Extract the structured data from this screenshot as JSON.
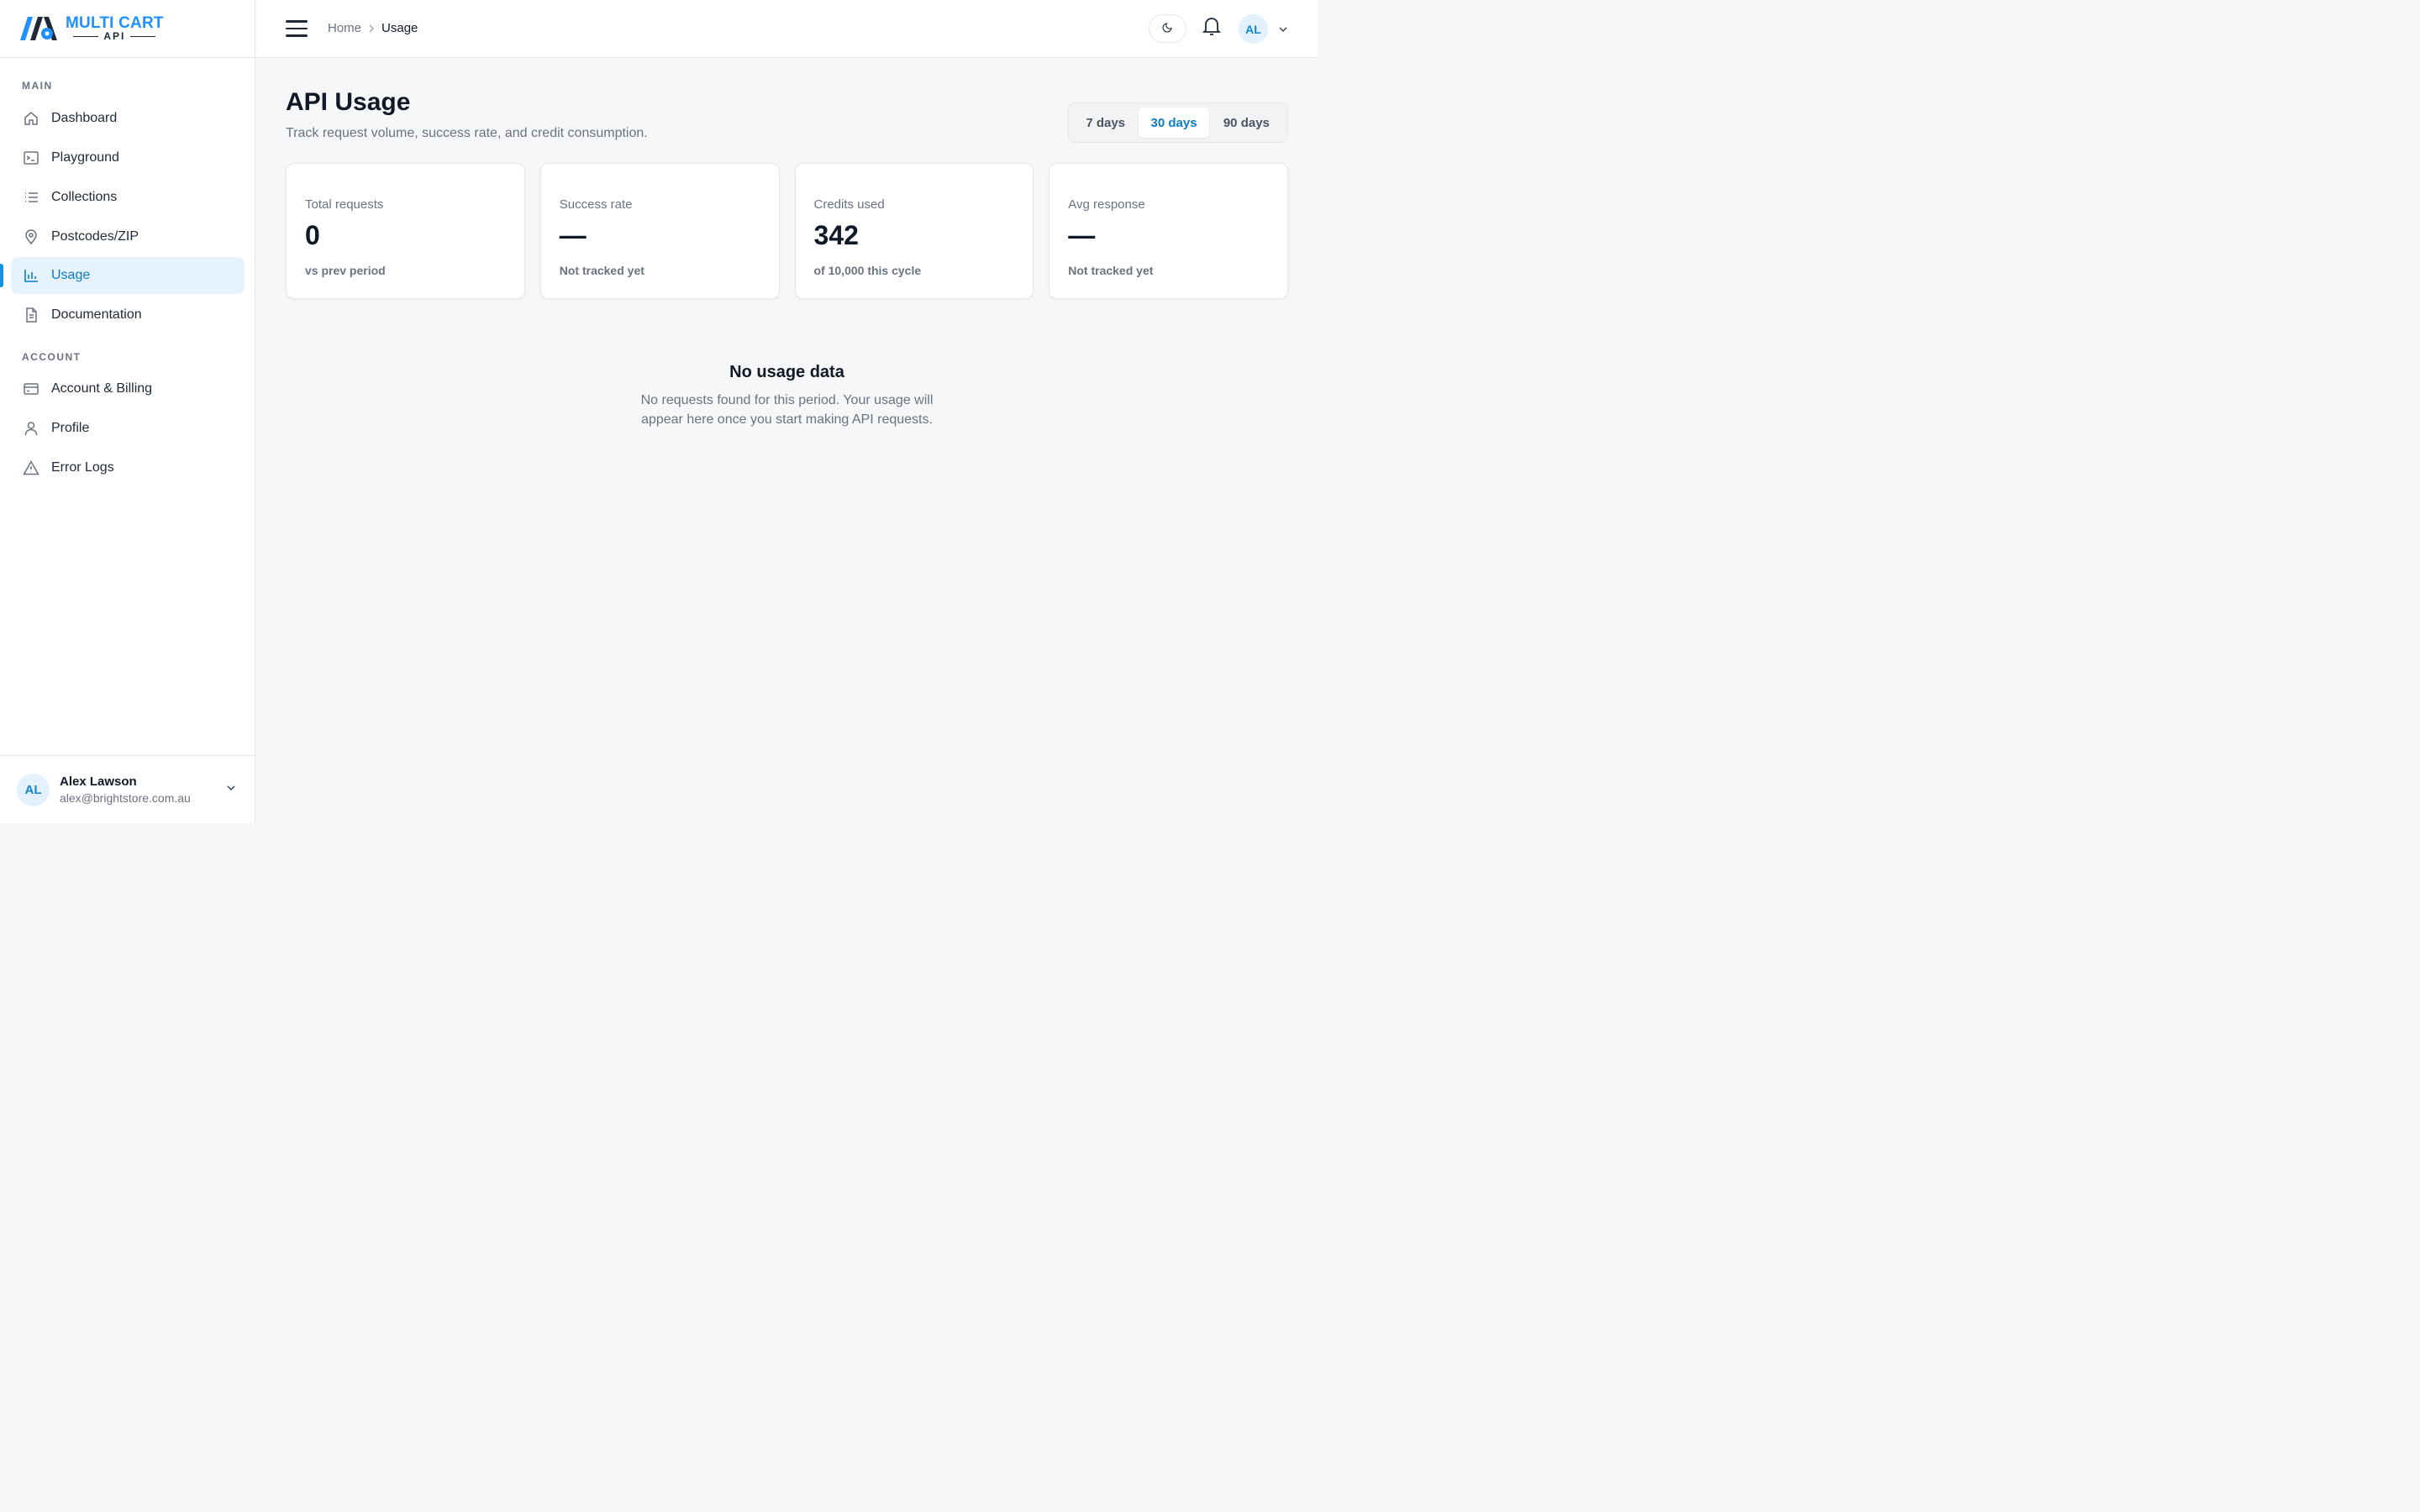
{
  "brand": {
    "line1": "MULTI CART",
    "line2": "API",
    "accent": "#1e90ff"
  },
  "sidebar": {
    "sections": [
      {
        "title": "MAIN",
        "items": [
          {
            "label": "Dashboard",
            "icon": "home-icon"
          },
          {
            "label": "Playground",
            "icon": "terminal-icon"
          },
          {
            "label": "Collections",
            "icon": "list-icon"
          },
          {
            "label": "Postcodes/ZIP",
            "icon": "map-pin-icon"
          },
          {
            "label": "Usage",
            "icon": "bar-chart-icon",
            "active": true
          },
          {
            "label": "Documentation",
            "icon": "document-icon"
          }
        ]
      },
      {
        "title": "ACCOUNT",
        "items": [
          {
            "label": "Account & Billing",
            "icon": "credit-card-icon"
          },
          {
            "label": "Profile",
            "icon": "user-icon"
          },
          {
            "label": "Error Logs",
            "icon": "warning-icon"
          }
        ]
      }
    ],
    "user": {
      "initials": "AL",
      "name": "Alex Lawson",
      "email": "alex@brightstore.com.au"
    }
  },
  "topbar": {
    "breadcrumb": {
      "home": "Home",
      "current": "Usage"
    },
    "avatar_initials": "AL"
  },
  "page": {
    "title": "API Usage",
    "subtitle": "Track request volume, success rate, and credit consumption.",
    "ranges": [
      {
        "label": "7 days",
        "selected": false
      },
      {
        "label": "30 days",
        "selected": true
      },
      {
        "label": "90 days",
        "selected": false
      }
    ]
  },
  "stats": [
    {
      "label": "Total requests",
      "value": "0",
      "note": "vs prev period"
    },
    {
      "label": "Success rate",
      "value": "—",
      "note": "Not tracked yet"
    },
    {
      "label": "Credits used",
      "value": "342",
      "note": "of 10,000 this cycle"
    },
    {
      "label": "Avg response",
      "value": "—",
      "note": "Not tracked yet"
    }
  ],
  "empty_state": {
    "title": "No usage data",
    "text": "No requests found for this period. Your usage will appear here once you start making API requests."
  },
  "colors": {
    "active_bg": "#e6f3fc",
    "active_text": "#0a7cc8",
    "page_bg": "#f6f7f9"
  }
}
